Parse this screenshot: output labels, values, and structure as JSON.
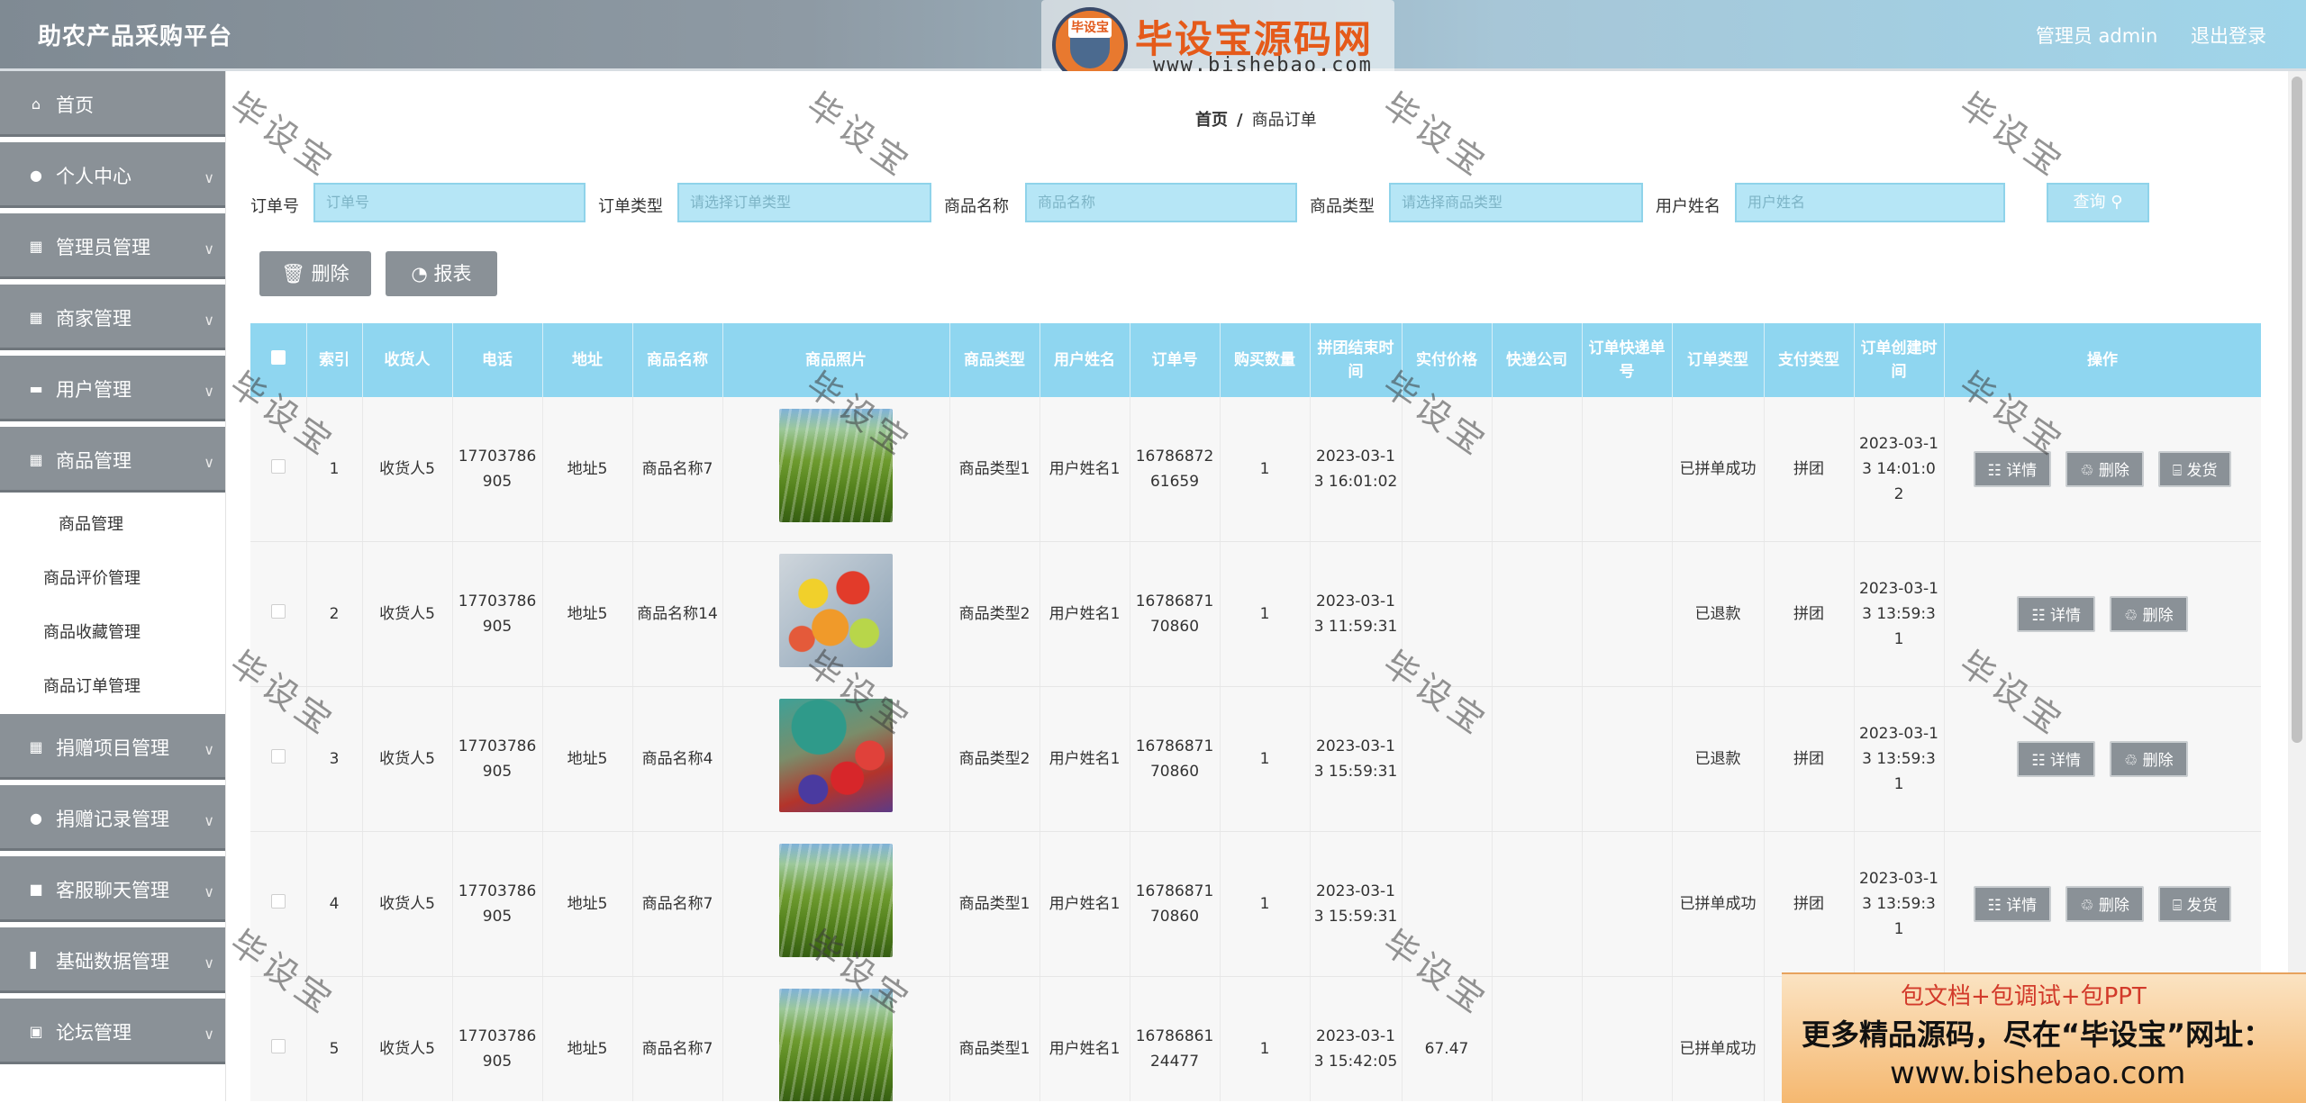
{
  "header": {
    "app_title": "助农产品采购平台",
    "user_label": "管理员 admin",
    "logout_label": "退出登录",
    "logo_tag": "毕设宝",
    "logo_text": "毕设宝源码网",
    "logo_url": "www.bishebao.com"
  },
  "sidebar": {
    "items": [
      {
        "label": "首页",
        "icon": "home-icon"
      },
      {
        "label": "个人中心",
        "icon": "user-icon"
      },
      {
        "label": "管理员管理",
        "icon": "grid-icon"
      },
      {
        "label": "商家管理",
        "icon": "grid-icon"
      },
      {
        "label": "用户管理",
        "icon": "id-card-icon"
      },
      {
        "label": "商品管理",
        "icon": "grid-icon"
      }
    ],
    "sub_items": [
      {
        "label": "商品管理"
      },
      {
        "label": "商品评价管理"
      },
      {
        "label": "商品收藏管理"
      },
      {
        "label": "商品订单管理"
      }
    ],
    "items_after": [
      {
        "label": "捐赠项目管理",
        "icon": "grid-icon"
      },
      {
        "label": "捐赠记录管理",
        "icon": "user-icon"
      },
      {
        "label": "客服聊天管理",
        "icon": "chat-icon"
      },
      {
        "label": "基础数据管理",
        "icon": "chart-icon"
      },
      {
        "label": "论坛管理",
        "icon": "forum-icon"
      }
    ]
  },
  "breadcrumb": {
    "home": "首页",
    "sep": "/",
    "current": "商品订单"
  },
  "search": {
    "order_no_label": "订单号",
    "order_no_placeholder": "订单号",
    "order_type_label": "订单类型",
    "order_type_placeholder": "请选择订单类型",
    "goods_name_label": "商品名称",
    "goods_name_placeholder": "商品名称",
    "goods_type_label": "商品类型",
    "goods_type_placeholder": "请选择商品类型",
    "user_name_label": "用户姓名",
    "user_name_placeholder": "用户姓名",
    "query_label": "查询"
  },
  "actions": {
    "delete_label": "删除",
    "report_label": "报表"
  },
  "table": {
    "headers": [
      "索引",
      "收货人",
      "电话",
      "地址",
      "商品名称",
      "商品照片",
      "商品类型",
      "用户姓名",
      "订单号",
      "购买数量",
      "拼团结束时间",
      "实付价格",
      "快递公司",
      "订单快递单号",
      "订单类型",
      "支付类型",
      "订单创建时间",
      "操作"
    ],
    "rows": [
      {
        "index": "1",
        "receiver": "收货人5",
        "phone": "17703786905",
        "address": "地址5",
        "goods_name": "商品名称7",
        "image": "field",
        "goods_type": "商品类型1",
        "user_name": "用户姓名1",
        "order_no": "1678687261659",
        "qty": "1",
        "group_end": "2023-03-13 16:01:02",
        "paid": "",
        "express": "",
        "express_no": "",
        "order_type": "已拼单成功",
        "pay_type": "拼团",
        "created": "2023-03-13 14:01:02",
        "ops": [
          "详情",
          "删除",
          "发货"
        ]
      },
      {
        "index": "2",
        "receiver": "收货人5",
        "phone": "17703786905",
        "address": "地址5",
        "goods_name": "商品名称14",
        "image": "fruit",
        "goods_type": "商品类型2",
        "user_name": "用户姓名1",
        "order_no": "1678687170860",
        "qty": "1",
        "group_end": "2023-03-13 11:59:31",
        "paid": "",
        "express": "",
        "express_no": "",
        "order_type": "已退款",
        "pay_type": "拼团",
        "created": "2023-03-13 13:59:31",
        "ops": [
          "详情",
          "删除"
        ]
      },
      {
        "index": "3",
        "receiver": "收货人5",
        "phone": "17703786905",
        "address": "地址5",
        "goods_name": "商品名称4",
        "image": "berry",
        "goods_type": "商品类型2",
        "user_name": "用户姓名1",
        "order_no": "1678687170860",
        "qty": "1",
        "group_end": "2023-03-13 15:59:31",
        "paid": "",
        "express": "",
        "express_no": "",
        "order_type": "已退款",
        "pay_type": "拼团",
        "created": "2023-03-13 13:59:31",
        "ops": [
          "详情",
          "删除"
        ]
      },
      {
        "index": "4",
        "receiver": "收货人5",
        "phone": "17703786905",
        "address": "地址5",
        "goods_name": "商品名称7",
        "image": "field",
        "goods_type": "商品类型1",
        "user_name": "用户姓名1",
        "order_no": "1678687170860",
        "qty": "1",
        "group_end": "2023-03-13 15:59:31",
        "paid": "",
        "express": "",
        "express_no": "",
        "order_type": "已拼单成功",
        "pay_type": "拼团",
        "created": "2023-03-13 13:59:31",
        "ops": [
          "详情",
          "删除",
          "发货"
        ]
      },
      {
        "index": "5",
        "receiver": "收货人5",
        "phone": "17703786905",
        "address": "地址5",
        "goods_name": "商品名称7",
        "image": "field",
        "goods_type": "商品类型1",
        "user_name": "用户姓名1",
        "order_no": "1678686124477",
        "qty": "1",
        "group_end": "2023-03-13 15:42:05",
        "paid": "67.47",
        "express": "",
        "express_no": "",
        "order_type": "已拼单成功",
        "pay_type": "",
        "created": "",
        "ops": []
      }
    ]
  },
  "watermark_text": "毕设宝",
  "promo": {
    "line1": "包文档+包调试+包PPT",
    "line2": "更多精品源码，尽在“毕设宝”网址：",
    "line3": "www.bishebao.com"
  },
  "colors": {
    "accent": "#8fd6f0",
    "button_gray": "#8a9197",
    "header_gray": "#7f8a93"
  }
}
